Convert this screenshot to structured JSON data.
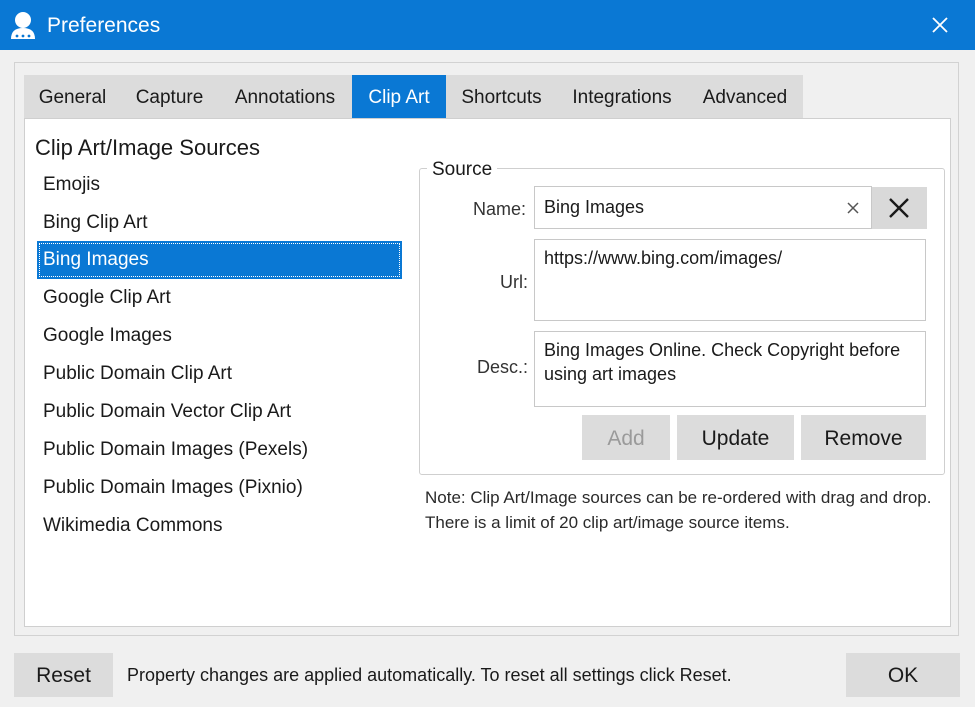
{
  "window": {
    "title": "Preferences"
  },
  "tabs": [
    {
      "label": "General"
    },
    {
      "label": "Capture"
    },
    {
      "label": "Annotations"
    },
    {
      "label": "Clip Art",
      "active": true
    },
    {
      "label": "Shortcuts"
    },
    {
      "label": "Integrations"
    },
    {
      "label": "Advanced"
    }
  ],
  "sources": {
    "title": "Clip Art/Image Sources",
    "items": [
      "Emojis",
      "Bing Clip Art",
      "Bing Images",
      "Google Clip Art",
      "Google Images",
      "Public Domain Clip Art",
      "Public Domain Vector Clip Art",
      "Public Domain Images (Pexels)",
      "Public Domain Images (Pixnio)",
      "Wikimedia Commons"
    ],
    "selected": "Bing Images"
  },
  "source_form": {
    "legend": "Source",
    "name_label": "Name:",
    "name_value": "Bing Images",
    "url_label": "Url:",
    "url_value": "https://www.bing.com/images/",
    "desc_label": "Desc.:",
    "desc_value": "Bing Images Online. Check Copyright before using art images",
    "add_label": "Add",
    "update_label": "Update",
    "remove_label": "Remove"
  },
  "note": "Note: Clip Art/Image sources can be re-ordered with drag and drop. There is a limit of 20 clip art/image source items.",
  "footer": {
    "reset_label": "Reset",
    "status": "Property changes are applied automatically. To reset all settings click Reset.",
    "ok_label": "OK"
  },
  "colors": {
    "accent": "#0a78d4",
    "button": "#dcdcdc",
    "background": "#f0f0f0"
  },
  "icons": {
    "app": "user-icon",
    "close": "close-icon",
    "clear": "clear-icon",
    "delete": "delete-icon"
  }
}
